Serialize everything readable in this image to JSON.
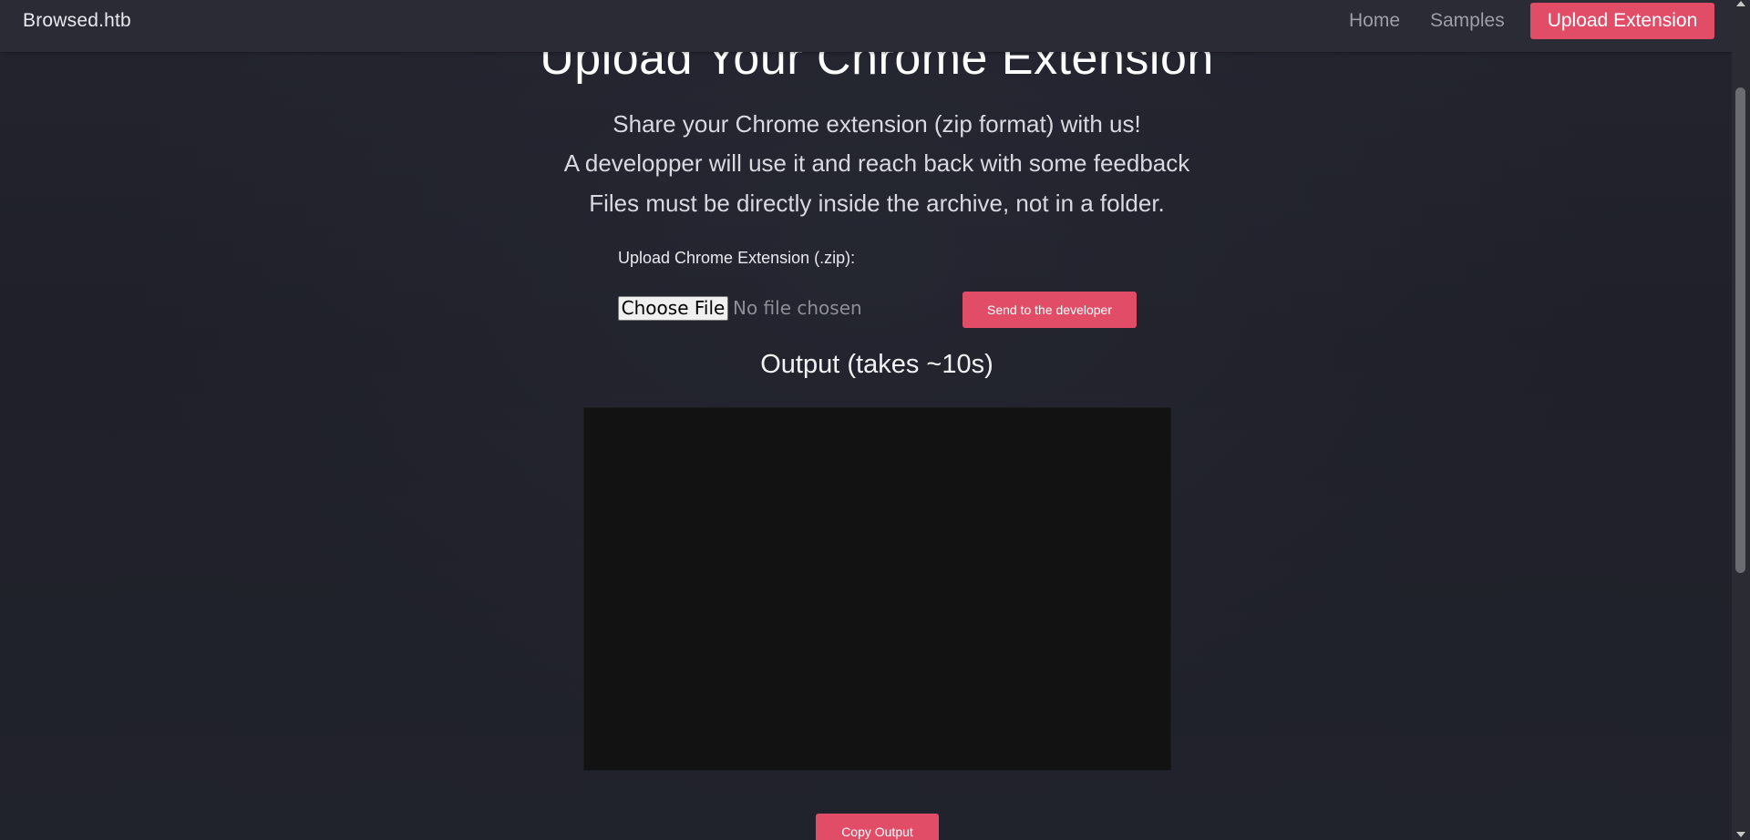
{
  "navbar": {
    "brand": "Browsed.htb",
    "links": {
      "home": "Home",
      "samples": "Samples",
      "upload": "Upload Extension"
    }
  },
  "main": {
    "title": "Upload Your Chrome Extension",
    "lead": [
      "Share your Chrome extension (zip format) with us!",
      "A developper will use it and reach back with some feedback",
      "Files must be directly inside the archive, not in a folder."
    ],
    "upload_label": "Upload Chrome Extension (.zip):",
    "file_input": {
      "button_label": "Choose File",
      "status": "No file chosen"
    },
    "send_button": "Send to the developer",
    "output_title": "Output (takes ~10s)",
    "output_content": "",
    "copy_button": "Copy Output"
  },
  "colors": {
    "accent": "#e14c67",
    "background": "#1f2029",
    "navbar": "#2a2b35",
    "output_bg": "#121212"
  }
}
